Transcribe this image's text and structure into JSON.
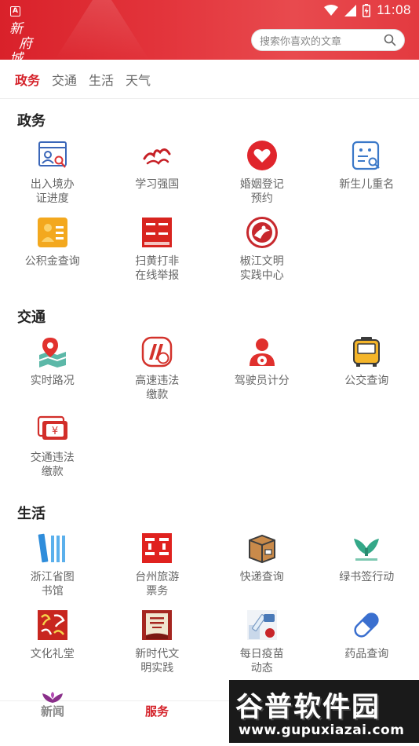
{
  "status_bar": {
    "time": "11:08"
  },
  "header": {
    "logo_text": [
      "新",
      "府",
      "城"
    ],
    "search_placeholder": "搜索你喜欢的文章"
  },
  "tabs": [
    {
      "label": "政务",
      "active": true
    },
    {
      "label": "交通",
      "active": false
    },
    {
      "label": "生活",
      "active": false
    },
    {
      "label": "天气",
      "active": false
    }
  ],
  "sections": [
    {
      "title": "政务",
      "items": [
        {
          "label": "出入境办\n证进度",
          "icon": "id-card-search-icon"
        },
        {
          "label": "学习强国",
          "icon": "xuexi-logo-icon"
        },
        {
          "label": "婚姻登记\n预约",
          "icon": "heart-icon"
        },
        {
          "label": "新生儿重名",
          "icon": "name-search-icon"
        },
        {
          "label": "公积金查询",
          "icon": "fund-icon"
        },
        {
          "label": "扫黄打非\n在线举报",
          "icon": "report-icon"
        },
        {
          "label": "椒江文明\n实践中心",
          "icon": "civilization-emblem-icon"
        }
      ]
    },
    {
      "title": "交通",
      "items": [
        {
          "label": "实时路况",
          "icon": "map-pin-icon"
        },
        {
          "label": "高速违法\n缴款",
          "icon": "highway-fine-icon"
        },
        {
          "label": "驾驶员计分",
          "icon": "driver-icon"
        },
        {
          "label": "公交查询",
          "icon": "bus-icon"
        },
        {
          "label": "交通违法\n缴款",
          "icon": "traffic-fine-icon"
        }
      ]
    },
    {
      "title": "生活",
      "items": [
        {
          "label": "浙江省图\n书馆",
          "icon": "books-icon"
        },
        {
          "label": "台州旅游\n票务",
          "icon": "travel-ticket-icon"
        },
        {
          "label": "快递查询",
          "icon": "package-icon"
        },
        {
          "label": "绿书签行动",
          "icon": "green-bookmark-icon"
        },
        {
          "label": "文化礼堂",
          "icon": "culture-hall-icon"
        },
        {
          "label": "新时代文\n明实践",
          "icon": "new-era-book-icon"
        },
        {
          "label": "每日疫苗\n动态",
          "icon": "vaccine-icon"
        },
        {
          "label": "药品查询",
          "icon": "pill-icon"
        }
      ]
    }
  ],
  "bottom_nav": [
    {
      "label": "新闻",
      "active": false
    },
    {
      "label": "服务",
      "active": true
    }
  ],
  "watermark": {
    "main": "谷普软件园",
    "url": "www.gupuxiazai.com"
  },
  "colors": {
    "brand_red": "#d5232b",
    "header_red": "#e3353c"
  }
}
